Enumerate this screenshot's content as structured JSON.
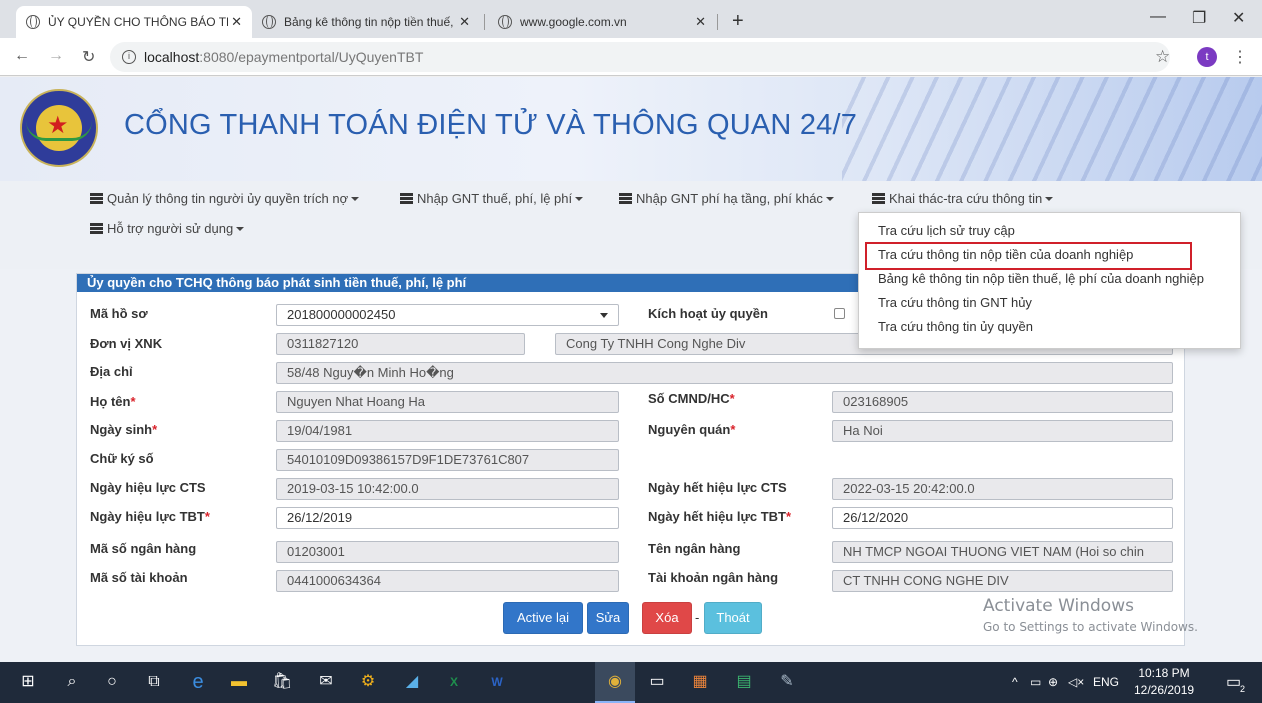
{
  "browser": {
    "tabs": [
      {
        "title": "ỦY QUYỀN CHO THÔNG BÁO TH"
      },
      {
        "title": "Bảng kê thông tin nộp tiền thuế,"
      },
      {
        "title": "www.google.com.vn"
      }
    ],
    "url_host": "localhost",
    "url_path": ":8080/epaymentportal/UyQuyenTBT",
    "profile_initial": "t"
  },
  "site": {
    "title": "CỔNG THANH TOÁN ĐIỆN TỬ VÀ THÔNG QUAN 24/7"
  },
  "menu": {
    "items": [
      {
        "label": "Quản lý thông tin người ủy quyền trích nợ"
      },
      {
        "label": "Nhập GNT thuế, phí, lệ phí"
      },
      {
        "label": "Nhập GNT phí hạ tầng, phí khác"
      },
      {
        "label": "Khai thác-tra cứu thông tin"
      },
      {
        "label": "Hỗ trợ người sử dụng"
      }
    ],
    "dropdown": [
      "Tra cứu lịch sử truy cập",
      "Tra cứu thông tin nộp tiền của doanh nghiệp",
      "Bảng kê thông tin nộp tiền thuế, lệ phí của doanh nghiệp",
      "Tra cứu thông tin GNT hủy",
      "Tra cứu thông tin ủy quyền"
    ]
  },
  "form": {
    "heading": "Ủy quyền cho TCHQ thông báo phát sinh tiền thuế, phí, lệ phí",
    "labels": {
      "ma_ho_so": "Mã hồ sơ",
      "kich_hoat": "Kích hoạt ủy quyền",
      "don_vi": "Đơn vị XNK",
      "dia_chi": "Địa chỉ",
      "ho_ten": "Họ tên",
      "cmnd": "Số CMND/HC",
      "ngay_sinh": "Ngày sinh",
      "nguyen_quan": "Nguyên quán",
      "chu_ky": "Chữ ký số",
      "hieu_luc_cts": "Ngày hiệu lực CTS",
      "het_hieu_luc_cts": "Ngày hết hiệu lực CTS",
      "hieu_luc_tbt": "Ngày hiệu lực TBT",
      "het_hieu_luc_tbt": "Ngày hết hiệu lực TBT",
      "ma_ngan_hang": "Mã số ngân hàng",
      "ten_ngan_hang": "Tên ngân hàng",
      "ma_tai_khoan": "Mã số tài khoản",
      "tk_ngan_hang": "Tài khoản ngân hàng"
    },
    "required_mark": "*",
    "values": {
      "ma_ho_so": "201800000002450",
      "ma_dv": "0311827120",
      "ten_dv": "Cong Ty TNHH Cong Nghe Div",
      "dia_chi": "58/48 Nguy�n Minh Ho�ng",
      "ho_ten": "Nguyen Nhat Hoang Ha",
      "cmnd": "023168905",
      "ngay_sinh": "19/04/1981",
      "nguyen_quan": "Ha Noi",
      "chu_ky": "54010109D09386157D9F1DE73761C807",
      "hieu_luc_cts": "2019-03-15 10:42:00.0",
      "het_hieu_luc_cts": "2022-03-15 20:42:00.0",
      "hieu_luc_tbt": "26/12/2019",
      "het_hieu_luc_tbt": "26/12/2020",
      "ma_ngan_hang": "01203001",
      "ten_ngan_hang": "NH TMCP NGOAI THUONG VIET NAM (Hoi so chin",
      "ma_tai_khoan": "0441000634364",
      "tk_ngan_hang": "CT TNHH CONG NGHE DIV"
    },
    "buttons": {
      "active": "Active lại",
      "sua": "Sửa",
      "xoa": "Xóa",
      "thoat": "Thoát",
      "separator": "-"
    }
  },
  "watermark": {
    "line1": "Activate Windows",
    "line2": "Go to Settings to activate Windows."
  },
  "taskbar": {
    "lang": "ENG",
    "time": "10:18 PM",
    "date": "12/26/2019",
    "notifications": "2"
  },
  "colors": {
    "primary_blue": "#2f6fb7",
    "btn_blue": "#3276c9",
    "btn_red": "#e04848",
    "btn_cyan": "#5bc0de",
    "highlight_red": "#d0202a"
  }
}
